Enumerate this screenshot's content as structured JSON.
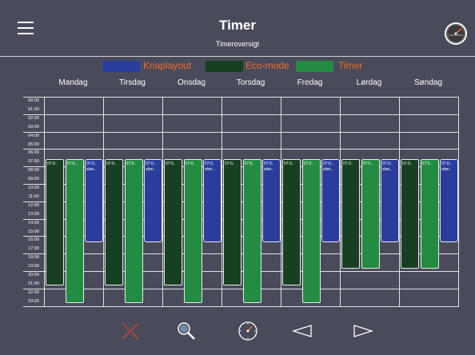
{
  "header": {
    "title": "Timer",
    "subtitle": "Timeroversigt",
    "menu_icon": "hamburger-menu-icon",
    "status_icon": "gauge-icon"
  },
  "legend": [
    {
      "label": "Knaplayout",
      "color": "#2b3d9c"
    },
    {
      "label": "Eco-mode",
      "color": "#173f22"
    },
    {
      "label": "Timer",
      "color": "#238c42"
    }
  ],
  "legend_text_color": "#f06a2a",
  "days": [
    "Mandag",
    "Tirsdag",
    "Onsdag",
    "Torsdag",
    "Fredag",
    "Lørdag",
    "Søndag"
  ],
  "hours": [
    "00:00",
    "01:00",
    "02:00",
    "03:00",
    "04:00",
    "05:00",
    "06:00",
    "07:00",
    "08:00",
    "09:00",
    "10:00",
    "11:00",
    "12:00",
    "13:00",
    "14:00",
    "15:00",
    "16:00",
    "17:00",
    "18:00",
    "19:00",
    "20:00",
    "21:00",
    "22:00",
    "23:00"
  ],
  "schedule": [
    {
      "day": "Mandag",
      "entries": [
        {
          "type": "Eco-mode",
          "label": "07:0..",
          "start": 7,
          "end": 21.5
        },
        {
          "type": "Timer",
          "label": "07:0..",
          "start": 7,
          "end": 23.5
        },
        {
          "type": "Knaplayout",
          "label": "07:0..",
          "sublabel": "stan..",
          "start": 7,
          "end": 16.5
        }
      ]
    },
    {
      "day": "Tirsdag",
      "entries": [
        {
          "type": "Eco-mode",
          "label": "07:0..",
          "start": 7,
          "end": 21.5
        },
        {
          "type": "Timer",
          "label": "07:0..",
          "start": 7,
          "end": 23.5
        },
        {
          "type": "Knaplayout",
          "label": "07:0..",
          "sublabel": "stan..",
          "start": 7,
          "end": 16.5
        }
      ]
    },
    {
      "day": "Onsdag",
      "entries": [
        {
          "type": "Eco-mode",
          "label": "07:0..",
          "start": 7,
          "end": 21.5
        },
        {
          "type": "Timer",
          "label": "07:0..",
          "start": 7,
          "end": 23.5
        },
        {
          "type": "Knaplayout",
          "label": "07:0..",
          "sublabel": "stan..",
          "start": 7,
          "end": 16.5
        }
      ]
    },
    {
      "day": "Torsdag",
      "entries": [
        {
          "type": "Eco-mode",
          "label": "07:0..",
          "start": 7,
          "end": 21.5
        },
        {
          "type": "Timer",
          "label": "07:0..",
          "start": 7,
          "end": 23.5
        },
        {
          "type": "Knaplayout",
          "label": "07:0..",
          "sublabel": "stan..",
          "start": 7,
          "end": 16.5
        }
      ]
    },
    {
      "day": "Fredag",
      "entries": [
        {
          "type": "Eco-mode",
          "label": "07:0..",
          "start": 7,
          "end": 21.5
        },
        {
          "type": "Timer",
          "label": "07:0..",
          "start": 7,
          "end": 23.5
        },
        {
          "type": "Knaplayout",
          "label": "07:0..",
          "sublabel": "stan..",
          "start": 7,
          "end": 16.5
        }
      ]
    },
    {
      "day": "Lørdag",
      "entries": [
        {
          "type": "Eco-mode",
          "label": "07:0..",
          "start": 7,
          "end": 19.5
        },
        {
          "type": "Timer",
          "label": "07:0..",
          "start": 7,
          "end": 19.5
        },
        {
          "type": "Knaplayout",
          "label": "07:0..",
          "sublabel": "stan..",
          "start": 7,
          "end": 16.5
        }
      ]
    },
    {
      "day": "Søndag",
      "entries": [
        {
          "type": "Eco-mode",
          "label": "07:0..",
          "start": 7,
          "end": 19.5
        },
        {
          "type": "Timer",
          "label": "07:0..",
          "start": 7,
          "end": 19.5
        },
        {
          "type": "Knaplayout",
          "label": "07:0..",
          "sublabel": "stan..",
          "start": 7,
          "end": 16.5
        }
      ]
    }
  ],
  "toolbar": [
    {
      "name": "delete-icon",
      "color": "#e0423a"
    },
    {
      "name": "search-icon",
      "color": "#ffffff"
    },
    {
      "name": "clock-icon",
      "color": "#ffffff"
    },
    {
      "name": "previous-icon",
      "color": "#ffffff"
    },
    {
      "name": "next-icon",
      "color": "#ffffff"
    }
  ]
}
